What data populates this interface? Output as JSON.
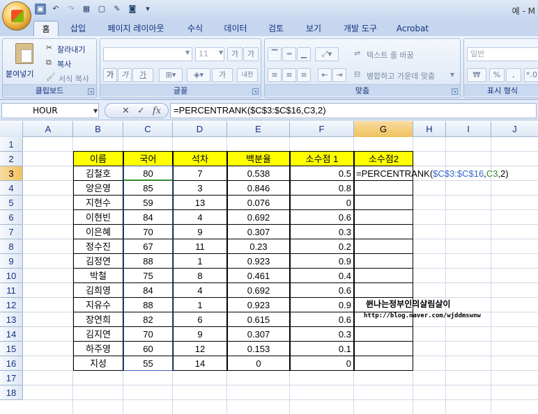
{
  "window": {
    "title_fragment": "예 - M"
  },
  "ribbon_tabs": [
    "홈",
    "삽입",
    "페이지 레이아웃",
    "수식",
    "데이터",
    "검토",
    "보기",
    "개발 도구",
    "Acrobat"
  ],
  "ribbon": {
    "clipboard": {
      "label": "클립보드",
      "paste": "붙여넣기",
      "cut": "잘라내기",
      "copy": "복사",
      "format_painter": "서식 복사"
    },
    "font": {
      "label": "글꼴",
      "size": "11",
      "grow": "가",
      "shrink": "가",
      "bold": "가",
      "italic": "가",
      "underline": "가",
      "font_color": "가",
      "phonetic": "내천"
    },
    "alignment": {
      "label": "맞춤",
      "wrap_text": "텍스트 줄 바꿈",
      "merge_center": "병합하고 가운데 맞춤"
    },
    "number": {
      "label": "표시 형식",
      "format": "일반",
      "currency": "₩",
      "percent": "%",
      "comma": ",",
      "increase_decimal": "*.0"
    }
  },
  "formula_bar": {
    "name_box": "HOUR",
    "cancel": "✕",
    "enter": "✓",
    "fx": "fx",
    "formula": "=PERCENTRANK($C$3:$C$16,C3,2)"
  },
  "columns": [
    "A",
    "B",
    "C",
    "D",
    "E",
    "F",
    "G",
    "H",
    "I",
    "J"
  ],
  "rows": [
    "1",
    "2",
    "3",
    "4",
    "5",
    "6",
    "7",
    "8",
    "9",
    "10",
    "11",
    "12",
    "13",
    "14",
    "15",
    "16",
    "17",
    "18"
  ],
  "table": {
    "headers": [
      "이름",
      "국어",
      "석차",
      "백분율",
      "소수점 1",
      "소수점2"
    ],
    "rows": [
      [
        "김철호",
        "80",
        "7",
        "0.538",
        "0.5"
      ],
      [
        "양은영",
        "85",
        "3",
        "0.846",
        "0.8"
      ],
      [
        "지현수",
        "59",
        "13",
        "0.076",
        "0"
      ],
      [
        "이현빈",
        "84",
        "4",
        "0.692",
        "0.6"
      ],
      [
        "이은혜",
        "70",
        "9",
        "0.307",
        "0.3"
      ],
      [
        "정수진",
        "67",
        "11",
        "0.23",
        "0.2"
      ],
      [
        "김정연",
        "88",
        "1",
        "0.923",
        "0.9"
      ],
      [
        "박철",
        "75",
        "8",
        "0.461",
        "0.4"
      ],
      [
        "김희영",
        "84",
        "4",
        "0.692",
        "0.6"
      ],
      [
        "지유수",
        "88",
        "1",
        "0.923",
        "0.9"
      ],
      [
        "장연희",
        "82",
        "6",
        "0.615",
        "0.6"
      ],
      [
        "김지연",
        "70",
        "9",
        "0.307",
        "0.3"
      ],
      [
        "하주영",
        "60",
        "12",
        "0.153",
        "0.1"
      ],
      [
        "지성",
        "55",
        "14",
        "0",
        "0"
      ]
    ],
    "editing_cell": {
      "prefix": "=PERCENTRANK(",
      "range": "$C$3:$C$16",
      "sep1": ",",
      "ref": "C3",
      "suffix": ",2)"
    }
  },
  "watermark": {
    "line1": "쒼나는정부인의살림살이",
    "line2": "http://blog.naver.com/wjddmswnw"
  },
  "colors": {
    "header_fill": "#ffff00",
    "range_ref": "#3366cc",
    "cell_ref": "#2e8b2e",
    "selection_header": "#f1c15f"
  }
}
